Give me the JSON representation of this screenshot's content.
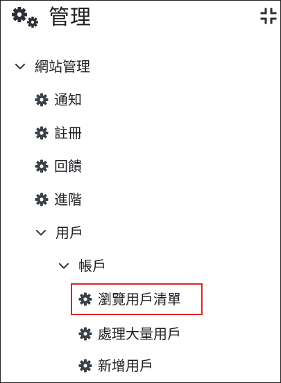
{
  "header": {
    "title": "管理",
    "icon": "gears-icon",
    "collapse_icon": "compress-icon"
  },
  "tree": {
    "site_admin": "網站管理",
    "notifications": "通知",
    "registration": "註冊",
    "feedback": "回饋",
    "advanced": "進階",
    "users": "用戶",
    "accounts": "帳戶",
    "browse_users": "瀏覽用戶清單",
    "bulk_actions": "處理大量用戶",
    "add_user": "新增用戶"
  },
  "colors": {
    "text": "#1d2125",
    "icon": "#3a4148",
    "highlight_border": "#e02424",
    "frame_border": "#222222"
  }
}
